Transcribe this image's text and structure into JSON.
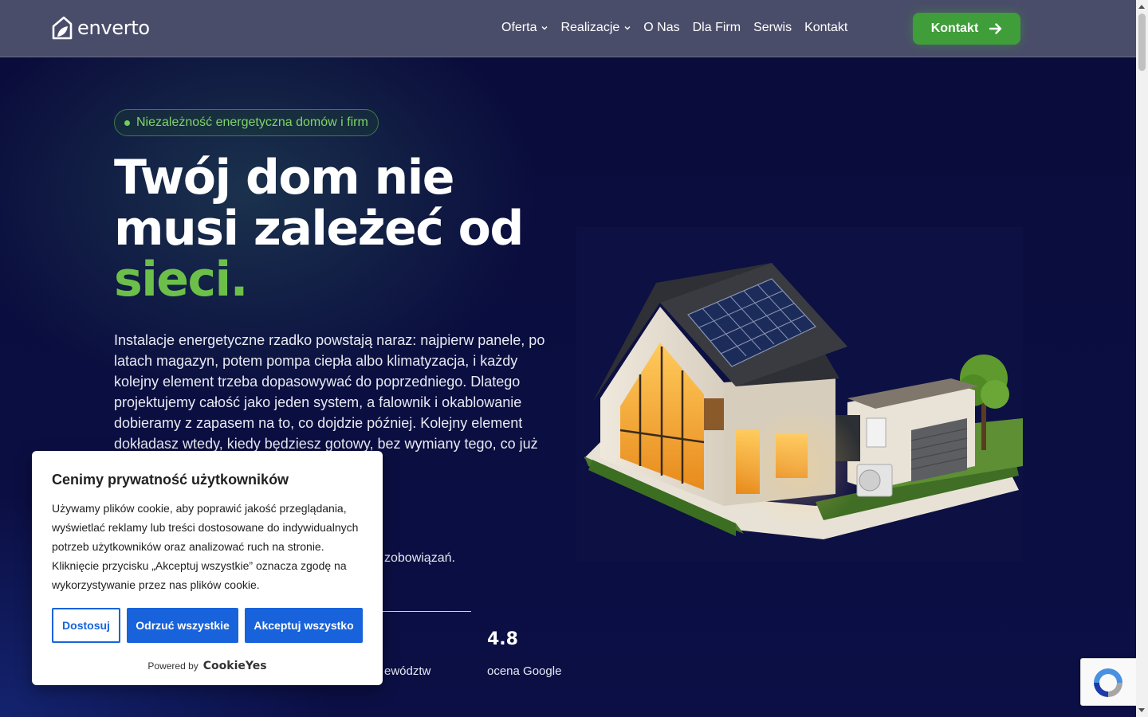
{
  "header": {
    "logo_text": "enverto",
    "nav": [
      {
        "label": "Oferta",
        "has_dropdown": true
      },
      {
        "label": "Realizacje",
        "has_dropdown": true
      },
      {
        "label": "O Nas",
        "has_dropdown": false
      },
      {
        "label": "Dla Firm",
        "has_dropdown": false
      },
      {
        "label": "Serwis",
        "has_dropdown": false
      },
      {
        "label": "Kontakt",
        "has_dropdown": false
      }
    ],
    "cta_label": "Kontakt"
  },
  "hero": {
    "badge": "Niezależność energetyczna domów i firm",
    "headline_line1": "Twój dom nie",
    "headline_line2": "musi zależeć od",
    "headline_accent": "sieci.",
    "lead": "Instalacje energetyczne rzadko powstają naraz: najpierw panele, po latach magazyn, potem pompa ciepła albo klimatyzacja, i każdy kolejny element trzeba dopasowywać do poprzedniego. Dlatego projektujemy całość jako jeden system, a falownik i okablowanie dobieramy z zapasem na to, co dojdzie później. Kolejny element dokładasz wtedy, kiedy będziesz gotowy, bez wymiany tego, co już",
    "partial_text": "zobowiązań.",
    "stats": [
      {
        "value": "",
        "label": "ewództw"
      },
      {
        "value": "4.8",
        "label": "ocena Google"
      }
    ]
  },
  "cookie_banner": {
    "title": "Cenimy prywatność użytkowników",
    "body": "Używamy plików cookie, aby poprawić jakość przeglądania, wyświetlać reklamy lub treści dostosowane do indywidualnych potrzeb użytkowników oraz analizować ruch na stronie. Kliknięcie przycisku „Akceptuj wszystkie” oznacza zgodę na wykorzystywanie przez nas plików cookie.",
    "btn_customize": "Dostosuj",
    "btn_reject": "Odrzuć wszystkie",
    "btn_accept": "Akceptuj wszystko",
    "powered_by": "Powered by",
    "powered_brand": "CookieYes"
  },
  "colors": {
    "accent_green": "#6cc04a",
    "cta_green": "#3f9d3a",
    "cookie_blue": "#1863dc",
    "bg_navy": "#0b0e3a"
  }
}
